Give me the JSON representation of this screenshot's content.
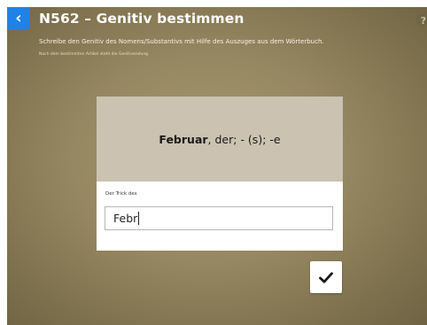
{
  "header": {
    "back_glyph": "‹",
    "title": "N562 – Genitiv bestimmen",
    "help_glyph": "?",
    "instruction": "Schreibe den Genitiv des Nomens/Substantivs mit Hilfe des Auszuges aus dem Wörterbuch.",
    "sub_instruction": "Nach dem bestimmten Artikel steht die Genitivendung."
  },
  "card": {
    "headword": "Februar",
    "grammar_info": ", der; - (s); -e",
    "field_label": "Der Trick des",
    "answer_value": "Febr"
  },
  "icons": {
    "back": "chevron-left-icon",
    "help": "question-circle-icon",
    "submit": "check-icon"
  },
  "colors": {
    "accent": "#1f82e8",
    "card_top": "#cbc2b1",
    "background": "#958761"
  }
}
